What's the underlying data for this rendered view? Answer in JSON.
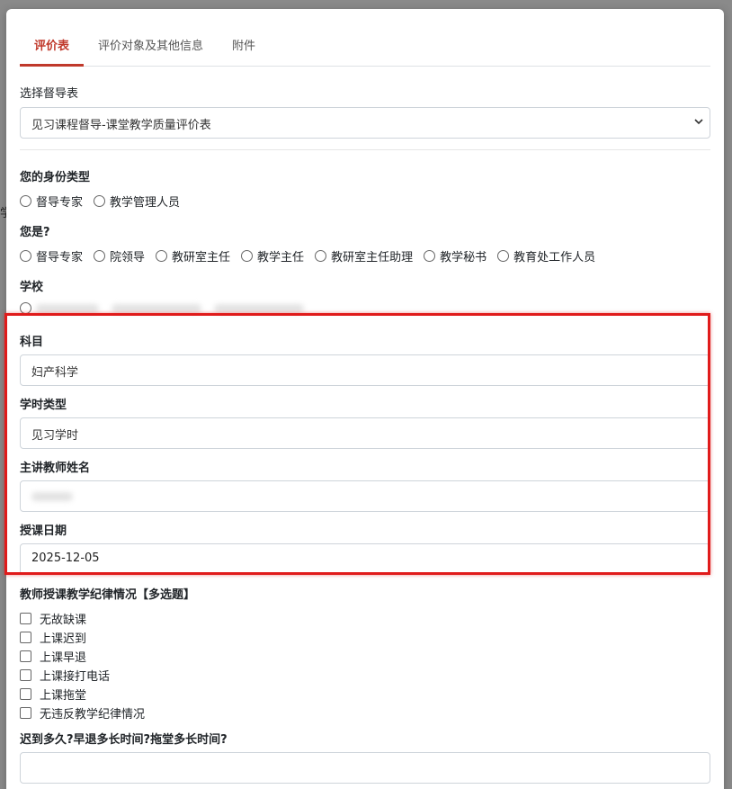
{
  "tabs": [
    {
      "label": "评价表",
      "active": true
    },
    {
      "label": "评价对象及其他信息",
      "active": false
    },
    {
      "label": "附件",
      "active": false
    }
  ],
  "form_select": {
    "label": "选择督导表",
    "value": "见习课程督导-课堂教学质量评价表"
  },
  "identity_type": {
    "label": "您的身份类型",
    "options": [
      "督导专家",
      "教学管理人员"
    ]
  },
  "role": {
    "label": "您是?",
    "options": [
      "督导专家",
      "院领导",
      "教研室主任",
      "教学主任",
      "教研室主任助理",
      "教学秘书",
      "教育处工作人员"
    ]
  },
  "school": {
    "label": "学校"
  },
  "subject": {
    "label": "科目",
    "value": "妇产科学"
  },
  "hour_type": {
    "label": "学时类型",
    "value": "见习学时"
  },
  "teacher_name": {
    "label": "主讲教师姓名"
  },
  "lecture_date": {
    "label": "授课日期",
    "value": "2025-12-05"
  },
  "discipline": {
    "label": "教师授课教学纪律情况【多选题】",
    "options": [
      "无故缺课",
      "上课迟到",
      "上课早退",
      "上课接打电话",
      "上课拖堂",
      "无违反教学纪律情况"
    ]
  },
  "lateness": {
    "label": "迟到多久?早退多长时间?拖堂多长时间?"
  },
  "side_text": "学",
  "colors": {
    "accent": "#c0392b",
    "highlight": "#e01b1b"
  }
}
